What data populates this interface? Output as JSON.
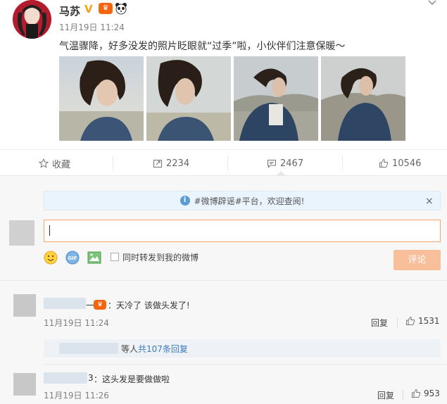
{
  "post": {
    "username": "马苏",
    "verified_mark": "V",
    "member_badge": "vip-badge",
    "time": "11月19日 11:24",
    "text": "气温骤降，好多没发的照片眨眼就“过季”啦，小伙伴们注意保暖～"
  },
  "actions": {
    "favorite_label": "收藏",
    "repost_count": "2234",
    "comment_count": "2467",
    "like_count": "10546"
  },
  "notice": {
    "text": "#微博辟谣#平台，欢迎查阅!",
    "close": "×"
  },
  "composer": {
    "input_value": "",
    "share_label": "同时转发到我的微博",
    "submit_label": "评论"
  },
  "comments": [
    {
      "name_suffix": "一",
      "text": "：天冷了 该做头发了!",
      "time": "11月19日 11:24",
      "reply_label": "回复",
      "likes": "1531",
      "replies_by": "等人",
      "replies_count": "共107条回复"
    },
    {
      "name_suffix": "3",
      "text": "：这头发是要做做啦",
      "time": "11月19日 11:26",
      "reply_label": "回复",
      "likes": "953"
    }
  ],
  "colors": {
    "accent_orange": "#f6a66b",
    "submit_bg": "#f9bf9a",
    "link_blue": "#3b7cc1",
    "notice_bg": "#eaf4fc"
  }
}
